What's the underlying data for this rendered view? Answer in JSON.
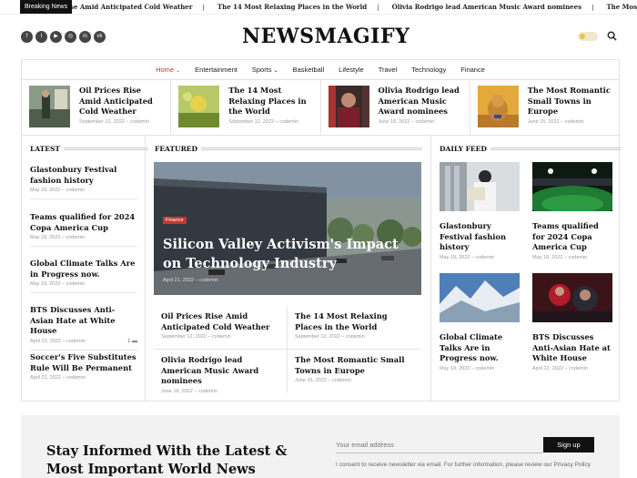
{
  "ticker": {
    "label": "Breaking News",
    "items": [
      "Oil Prices Rise Amid Anticipated Cold Weather",
      "The 14 Most Relaxing Places in the World",
      "Olivia Rodrigo lead American Music Award nominees",
      "The Most Romantic Small Towns in Europe"
    ]
  },
  "header": {
    "logo": "NEWSMAGIFY",
    "social_icons": [
      "facebook-icon",
      "twitter-icon",
      "youtube-icon",
      "instagram-icon",
      "linkedin-icon",
      "vk-icon"
    ]
  },
  "nav": {
    "items": [
      {
        "label": "Home",
        "active": true,
        "dropdown": true
      },
      {
        "label": "Entertainment",
        "active": false,
        "dropdown": false
      },
      {
        "label": "Sports",
        "active": false,
        "dropdown": true
      },
      {
        "label": "Basketball",
        "active": false,
        "dropdown": false
      },
      {
        "label": "Lifestyle",
        "active": false,
        "dropdown": false
      },
      {
        "label": "Travel",
        "active": false,
        "dropdown": false
      },
      {
        "label": "Technology",
        "active": false,
        "dropdown": false
      },
      {
        "label": "Finance",
        "active": false,
        "dropdown": false
      }
    ]
  },
  "top_strip": [
    {
      "title": "Oil Prices Rise Amid Anticipated Cold Weather",
      "date": "September 12, 2022",
      "author": "codemin"
    },
    {
      "title": "The 14 Most Relaxing Places in the World",
      "date": "September 12, 2022",
      "author": "codemin"
    },
    {
      "title": "Olivia Rodrigo lead American Music Award nominees",
      "date": "June 16, 2022",
      "author": "codemin"
    },
    {
      "title": "The Most Romantic Small Towns in Europe",
      "date": "June 15, 2022",
      "author": "codemin"
    }
  ],
  "latest": {
    "heading": "LATEST",
    "items": [
      {
        "title": "Glastonbury Festival fashion history",
        "date": "May 18, 2022",
        "author": "codemin",
        "comments": ""
      },
      {
        "title": "Teams qualified for 2024 Copa America Cup",
        "date": "May 18, 2022",
        "author": "codemin",
        "comments": ""
      },
      {
        "title": "Global Climate Talks Are in Progress now.",
        "date": "May 18, 2022",
        "author": "codemin",
        "comments": ""
      },
      {
        "title": "BTS Discusses Anti-Asian Hate at White House",
        "date": "April 22, 2022",
        "author": "codemin",
        "comments": "1"
      },
      {
        "title": "Soccer's Five Substitutes Rule Will Be Permanent",
        "date": "April 22, 2022",
        "author": "codemin",
        "comments": ""
      }
    ]
  },
  "featured": {
    "heading": "FEATURED",
    "main": {
      "category": "Finance",
      "title": "Silicon Valley Activism's Impact on Technology Industry",
      "date": "April 21, 2022",
      "author": "codemin"
    },
    "grid": [
      {
        "title": "Oil Prices Rise Amid Anticipated Cold Weather",
        "date": "September 12, 2022",
        "author": "codemin"
      },
      {
        "title": "The 14 Most Relaxing Places in the World",
        "date": "September 12, 2022",
        "author": "codemin"
      },
      {
        "title": "Olivia Rodrigo lead American Music Award nominees",
        "date": "June 16, 2022",
        "author": "codemin"
      },
      {
        "title": "The Most Romantic Small Towns in Europe",
        "date": "June 15, 2022",
        "author": "codemin"
      }
    ]
  },
  "daily": {
    "heading": "DAILY FEED",
    "items": [
      {
        "title": "Glastonbury Festival fashion history",
        "date": "May 18, 2022",
        "author": "codemin"
      },
      {
        "title": "Teams qualified for 2024 Copa America Cup",
        "date": "May 18, 2022",
        "author": "codemin"
      },
      {
        "title": "Global Climate Talks Are in Progress now.",
        "date": "May 18, 2022",
        "author": "codemin"
      },
      {
        "title": "BTS Discusses Anti-Asian Hate at White House",
        "date": "April 22, 2022",
        "author": "codemin"
      }
    ]
  },
  "newsletter": {
    "heading": "Stay Informed With the Latest & Most Important World News",
    "placeholder": "Your email address",
    "button": "Sign up",
    "consent": "I consent to receive newsletter via email. For further information, please review our Privacy Policy"
  },
  "colors": {
    "accent": "#c0392b",
    "dark": "#111111",
    "border": "#e3e3e3"
  }
}
